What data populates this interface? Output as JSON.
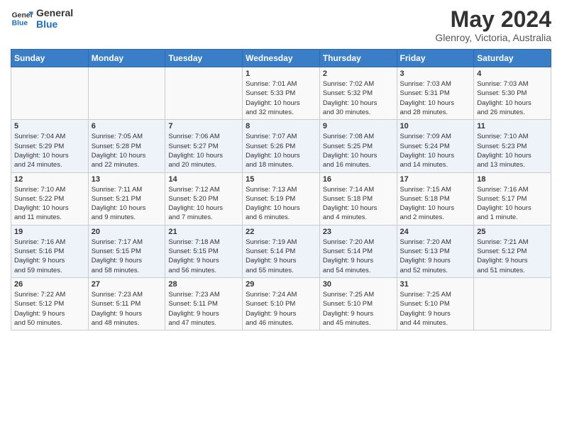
{
  "header": {
    "logo_line1": "General",
    "logo_line2": "Blue",
    "month_year": "May 2024",
    "location": "Glenroy, Victoria, Australia"
  },
  "weekdays": [
    "Sunday",
    "Monday",
    "Tuesday",
    "Wednesday",
    "Thursday",
    "Friday",
    "Saturday"
  ],
  "weeks": [
    [
      {
        "day": "",
        "info": ""
      },
      {
        "day": "",
        "info": ""
      },
      {
        "day": "",
        "info": ""
      },
      {
        "day": "1",
        "info": "Sunrise: 7:01 AM\nSunset: 5:33 PM\nDaylight: 10 hours\nand 32 minutes."
      },
      {
        "day": "2",
        "info": "Sunrise: 7:02 AM\nSunset: 5:32 PM\nDaylight: 10 hours\nand 30 minutes."
      },
      {
        "day": "3",
        "info": "Sunrise: 7:03 AM\nSunset: 5:31 PM\nDaylight: 10 hours\nand 28 minutes."
      },
      {
        "day": "4",
        "info": "Sunrise: 7:03 AM\nSunset: 5:30 PM\nDaylight: 10 hours\nand 26 minutes."
      }
    ],
    [
      {
        "day": "5",
        "info": "Sunrise: 7:04 AM\nSunset: 5:29 PM\nDaylight: 10 hours\nand 24 minutes."
      },
      {
        "day": "6",
        "info": "Sunrise: 7:05 AM\nSunset: 5:28 PM\nDaylight: 10 hours\nand 22 minutes."
      },
      {
        "day": "7",
        "info": "Sunrise: 7:06 AM\nSunset: 5:27 PM\nDaylight: 10 hours\nand 20 minutes."
      },
      {
        "day": "8",
        "info": "Sunrise: 7:07 AM\nSunset: 5:26 PM\nDaylight: 10 hours\nand 18 minutes."
      },
      {
        "day": "9",
        "info": "Sunrise: 7:08 AM\nSunset: 5:25 PM\nDaylight: 10 hours\nand 16 minutes."
      },
      {
        "day": "10",
        "info": "Sunrise: 7:09 AM\nSunset: 5:24 PM\nDaylight: 10 hours\nand 14 minutes."
      },
      {
        "day": "11",
        "info": "Sunrise: 7:10 AM\nSunset: 5:23 PM\nDaylight: 10 hours\nand 13 minutes."
      }
    ],
    [
      {
        "day": "12",
        "info": "Sunrise: 7:10 AM\nSunset: 5:22 PM\nDaylight: 10 hours\nand 11 minutes."
      },
      {
        "day": "13",
        "info": "Sunrise: 7:11 AM\nSunset: 5:21 PM\nDaylight: 10 hours\nand 9 minutes."
      },
      {
        "day": "14",
        "info": "Sunrise: 7:12 AM\nSunset: 5:20 PM\nDaylight: 10 hours\nand 7 minutes."
      },
      {
        "day": "15",
        "info": "Sunrise: 7:13 AM\nSunset: 5:19 PM\nDaylight: 10 hours\nand 6 minutes."
      },
      {
        "day": "16",
        "info": "Sunrise: 7:14 AM\nSunset: 5:18 PM\nDaylight: 10 hours\nand 4 minutes."
      },
      {
        "day": "17",
        "info": "Sunrise: 7:15 AM\nSunset: 5:18 PM\nDaylight: 10 hours\nand 2 minutes."
      },
      {
        "day": "18",
        "info": "Sunrise: 7:16 AM\nSunset: 5:17 PM\nDaylight: 10 hours\nand 1 minute."
      }
    ],
    [
      {
        "day": "19",
        "info": "Sunrise: 7:16 AM\nSunset: 5:16 PM\nDaylight: 9 hours\nand 59 minutes."
      },
      {
        "day": "20",
        "info": "Sunrise: 7:17 AM\nSunset: 5:15 PM\nDaylight: 9 hours\nand 58 minutes."
      },
      {
        "day": "21",
        "info": "Sunrise: 7:18 AM\nSunset: 5:15 PM\nDaylight: 9 hours\nand 56 minutes."
      },
      {
        "day": "22",
        "info": "Sunrise: 7:19 AM\nSunset: 5:14 PM\nDaylight: 9 hours\nand 55 minutes."
      },
      {
        "day": "23",
        "info": "Sunrise: 7:20 AM\nSunset: 5:14 PM\nDaylight: 9 hours\nand 54 minutes."
      },
      {
        "day": "24",
        "info": "Sunrise: 7:20 AM\nSunset: 5:13 PM\nDaylight: 9 hours\nand 52 minutes."
      },
      {
        "day": "25",
        "info": "Sunrise: 7:21 AM\nSunset: 5:12 PM\nDaylight: 9 hours\nand 51 minutes."
      }
    ],
    [
      {
        "day": "26",
        "info": "Sunrise: 7:22 AM\nSunset: 5:12 PM\nDaylight: 9 hours\nand 50 minutes."
      },
      {
        "day": "27",
        "info": "Sunrise: 7:23 AM\nSunset: 5:11 PM\nDaylight: 9 hours\nand 48 minutes."
      },
      {
        "day": "28",
        "info": "Sunrise: 7:23 AM\nSunset: 5:11 PM\nDaylight: 9 hours\nand 47 minutes."
      },
      {
        "day": "29",
        "info": "Sunrise: 7:24 AM\nSunset: 5:10 PM\nDaylight: 9 hours\nand 46 minutes."
      },
      {
        "day": "30",
        "info": "Sunrise: 7:25 AM\nSunset: 5:10 PM\nDaylight: 9 hours\nand 45 minutes."
      },
      {
        "day": "31",
        "info": "Sunrise: 7:25 AM\nSunset: 5:10 PM\nDaylight: 9 hours\nand 44 minutes."
      },
      {
        "day": "",
        "info": ""
      }
    ]
  ]
}
